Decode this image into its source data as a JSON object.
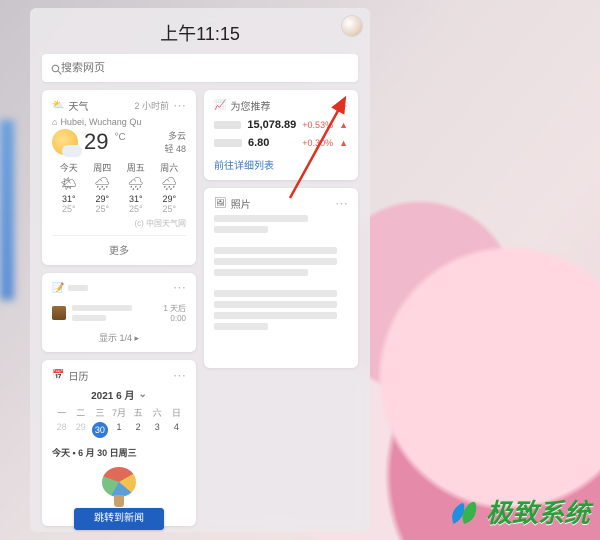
{
  "clock": "上午11:15",
  "search": {
    "placeholder": "搜索网页"
  },
  "weather": {
    "title": "天气",
    "sub": "2 小时前",
    "location": "Hubei, Wuchang Qu",
    "temp": "29",
    "unit": "°C",
    "condition": "多云",
    "aqi": "轻 48",
    "forecast": [
      {
        "day": "今天",
        "glyph": "🌤",
        "hi": "31°",
        "lo": "25°"
      },
      {
        "day": "周四",
        "glyph": "🌧",
        "hi": "29°",
        "lo": "25°"
      },
      {
        "day": "周五",
        "glyph": "🌧",
        "hi": "31°",
        "lo": "25°"
      },
      {
        "day": "周六",
        "glyph": "🌧",
        "hi": "29°",
        "lo": "25°"
      }
    ],
    "source": "(c) 中国天气网",
    "more": "更多"
  },
  "finance": {
    "title": "为您推荐",
    "rows": [
      {
        "price": "15,078.89",
        "change": "+0.53%"
      },
      {
        "price": "6.80",
        "change": "+0.30%"
      }
    ],
    "link": "前往详细列表"
  },
  "todo": {
    "due_label": "1 天后",
    "time": "0:00",
    "footer": "显示 1/4 ▸"
  },
  "photos": {
    "title": "照片"
  },
  "calendar": {
    "title": "日历",
    "month": "2021 6 月",
    "dow": [
      "一",
      "二",
      "三",
      "7月",
      "五",
      "六",
      "日"
    ],
    "week": [
      "28",
      "29",
      "30",
      "1",
      "2",
      "3",
      "4"
    ],
    "today": 30,
    "event": "今天 • 6 月 30 日周三",
    "button": "跳转到新闻"
  },
  "watermark": "极致系统"
}
